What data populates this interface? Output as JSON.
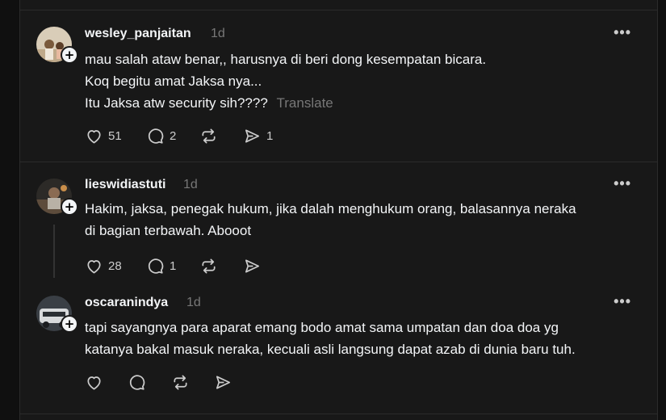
{
  "posts": [
    {
      "username": "wesley_panjaitan",
      "time": "1d",
      "lines": [
        "mau salah ataw benar,, harusnya di beri dong kesempatan bicara.",
        "Koq begitu amat Jaksa nya...",
        "Itu Jaksa atw security sih????"
      ],
      "translate_label": "Translate",
      "likes": "51",
      "replies": "2",
      "reposts": "",
      "shares": "1"
    },
    {
      "username": "lieswidiastuti",
      "time": "1d",
      "lines": [
        "Hakim, jaksa, penegak hukum, jika dalah menghukum orang, balasannya neraka",
        "di bagian terbawah. Abooot"
      ],
      "likes": "28",
      "replies": "1",
      "reposts": "",
      "shares": ""
    },
    {
      "username": "oscaranindya",
      "time": "1d",
      "lines": [
        "tapi sayangnya para aparat emang bodo amat sama umpatan dan doa doa yg",
        "katanya bakal masuk neraka, kecuali asli langsung dapat azab di dunia baru tuh."
      ],
      "likes": "",
      "replies": "",
      "reposts": "",
      "shares": ""
    }
  ],
  "icons": {
    "more": "more-dots-icon",
    "follow": "plus-icon",
    "like": "heart-icon",
    "reply": "comment-icon",
    "repost": "repost-icon",
    "share": "send-icon"
  },
  "colors": {
    "background": "#101010",
    "card": "#181818",
    "text": "#f3f5f7",
    "muted": "#777777",
    "border": "#2b2b2b"
  },
  "more_label": "•••",
  "plus_label": "+"
}
